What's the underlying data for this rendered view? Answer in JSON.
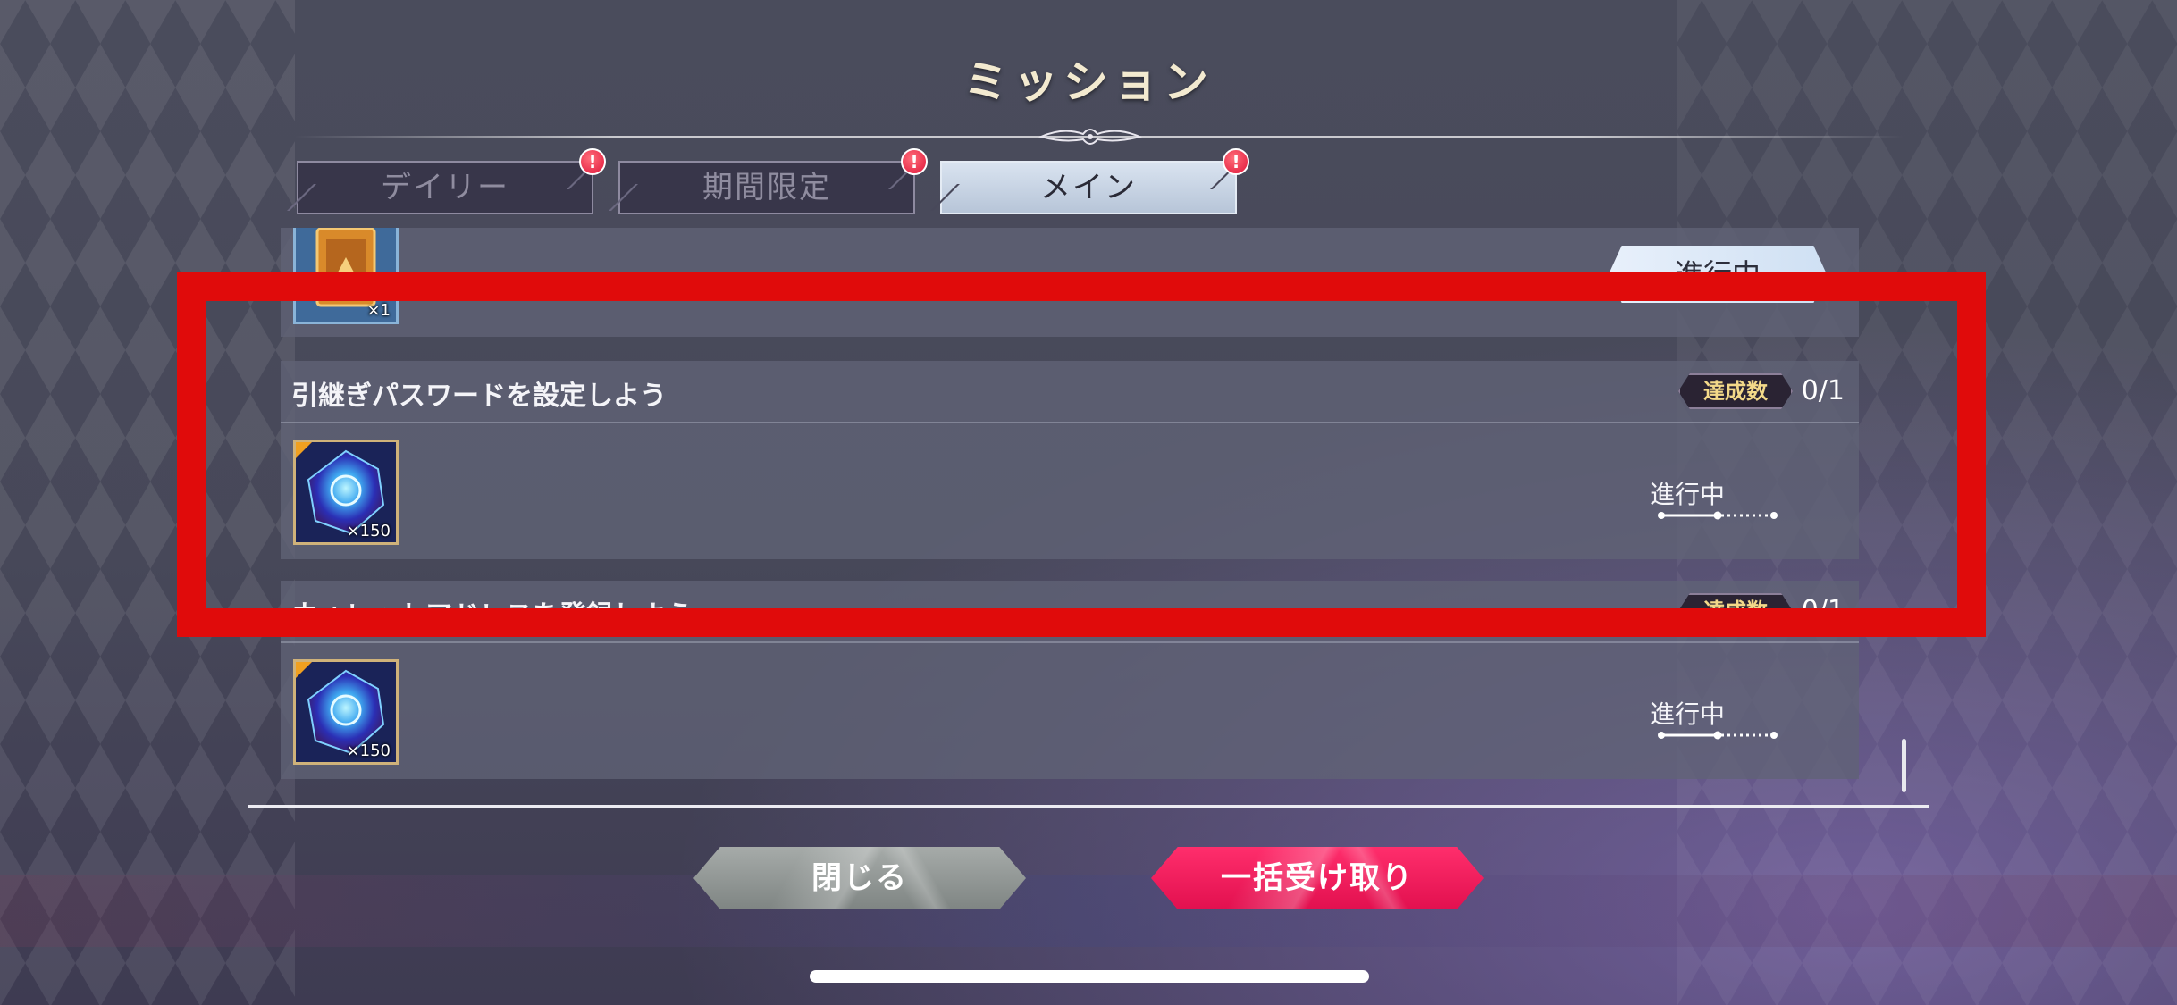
{
  "screen": {
    "title": "ミッション",
    "tabs": [
      {
        "label": "デイリー",
        "alert": "!",
        "active": false
      },
      {
        "label": "期間限定",
        "alert": "!",
        "active": false
      },
      {
        "label": "メイン",
        "alert": "!",
        "active": true
      }
    ]
  },
  "missions": [
    {
      "title": "",
      "reward_qty": "×1",
      "status": "進行中",
      "partial": true
    },
    {
      "title": "引継ぎパスワードを設定しよう",
      "achieve_label": "達成数",
      "achieve_count": "0/1",
      "reward_qty": "×150",
      "status": "進行中",
      "progress": 0.5
    },
    {
      "title": "ウォレットアドレスを登録しよう",
      "achieve_label": "達成数",
      "achieve_count": "0/1",
      "reward_qty": "×150",
      "status": "進行中",
      "progress": 0.5
    }
  ],
  "buttons": {
    "close": "閉じる",
    "collect_all": "一括受け取り"
  },
  "colors": {
    "accent_pink": "#e2104f",
    "highlight_red": "#e00b0b",
    "badge_gold_text": "#f3d989"
  }
}
